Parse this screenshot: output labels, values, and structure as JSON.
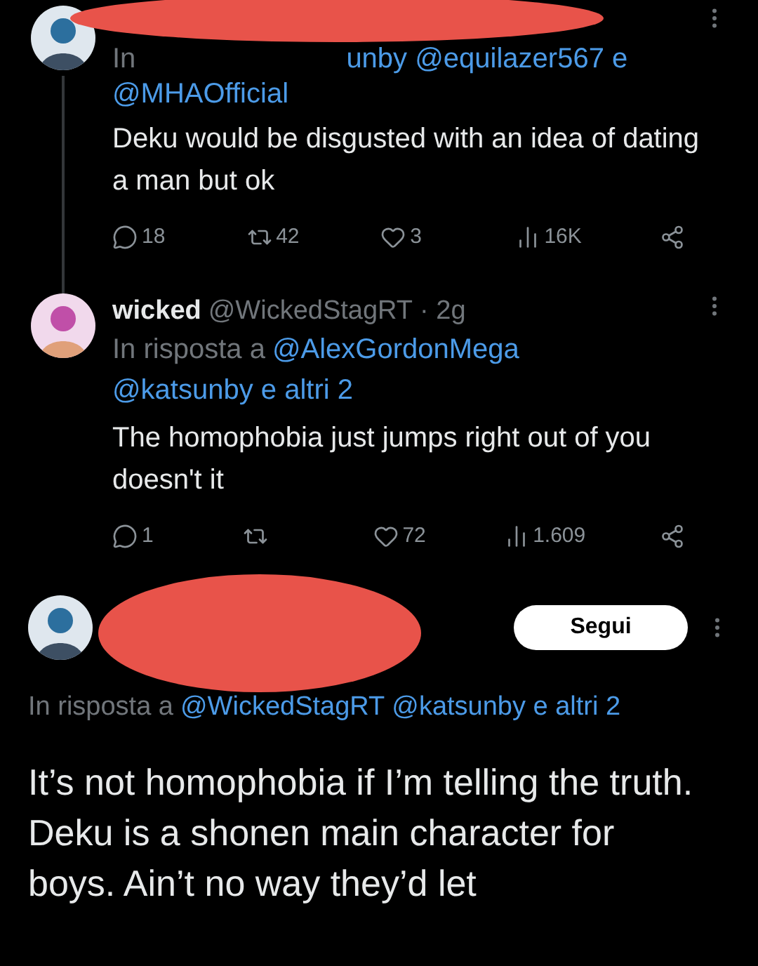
{
  "tweets": [
    {
      "kind": "redacted_header",
      "redacted": true,
      "reply_prefix": "In",
      "reply_tail": "unby @equilazer567 e",
      "mentions": [
        "@MHAOfficial"
      ],
      "text": "Deku would be disgusted with an idea of dating a man but ok",
      "thread_line": true,
      "actions": [
        {
          "kind": "reply",
          "count": "18"
        },
        {
          "kind": "repost",
          "count": "42"
        },
        {
          "kind": "like",
          "count": "3"
        },
        {
          "kind": "views",
          "count": "16K"
        },
        {
          "kind": "share"
        }
      ]
    },
    {
      "kind": "full_header",
      "name": "wicked",
      "handle": "@WickedStagRT",
      "time": "· 2g",
      "reply_prefix": "In risposta a",
      "mentions": [
        "@AlexGordonMega",
        "@katsunby e altri 2"
      ],
      "text": "The homophobia just jumps right out of you doesn't it",
      "actions": [
        {
          "kind": "reply",
          "count": "1"
        },
        {
          "kind": "repost"
        },
        {
          "kind": "like",
          "count": "72"
        },
        {
          "kind": "views",
          "count": "1.609"
        },
        {
          "kind": "share"
        }
      ]
    },
    {
      "kind": "focused",
      "redacted": true,
      "follow_label": "Segui",
      "reply_prefix": "In risposta a",
      "mentions": [
        "@WickedStagRT",
        "@katsunby e altri 2"
      ],
      "text": "It’s not homophobia if I’m telling the truth. Deku is a shonen main character for boys. Ain’t no way they’d let"
    }
  ]
}
